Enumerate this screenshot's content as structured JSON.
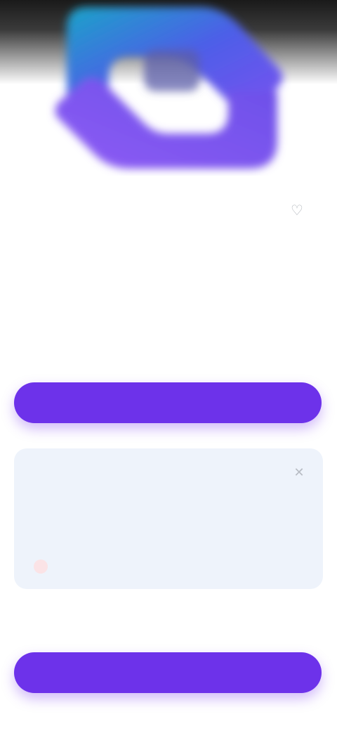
{
  "colors": {
    "accent": "#6d32ea",
    "card_background": "#eef3fb",
    "tag_text": "#e2536a"
  },
  "header": {
    "logo_icon": "app-logo-icon",
    "eyebrow": "",
    "favorite_icon": "heart-icon"
  },
  "main": {
    "title": "",
    "description": "",
    "meta": "",
    "primary_button_label": ""
  },
  "info_card": {
    "title": "",
    "close_icon": "close-icon",
    "body": "",
    "tag": ""
  },
  "footer": {
    "button_label": ""
  }
}
